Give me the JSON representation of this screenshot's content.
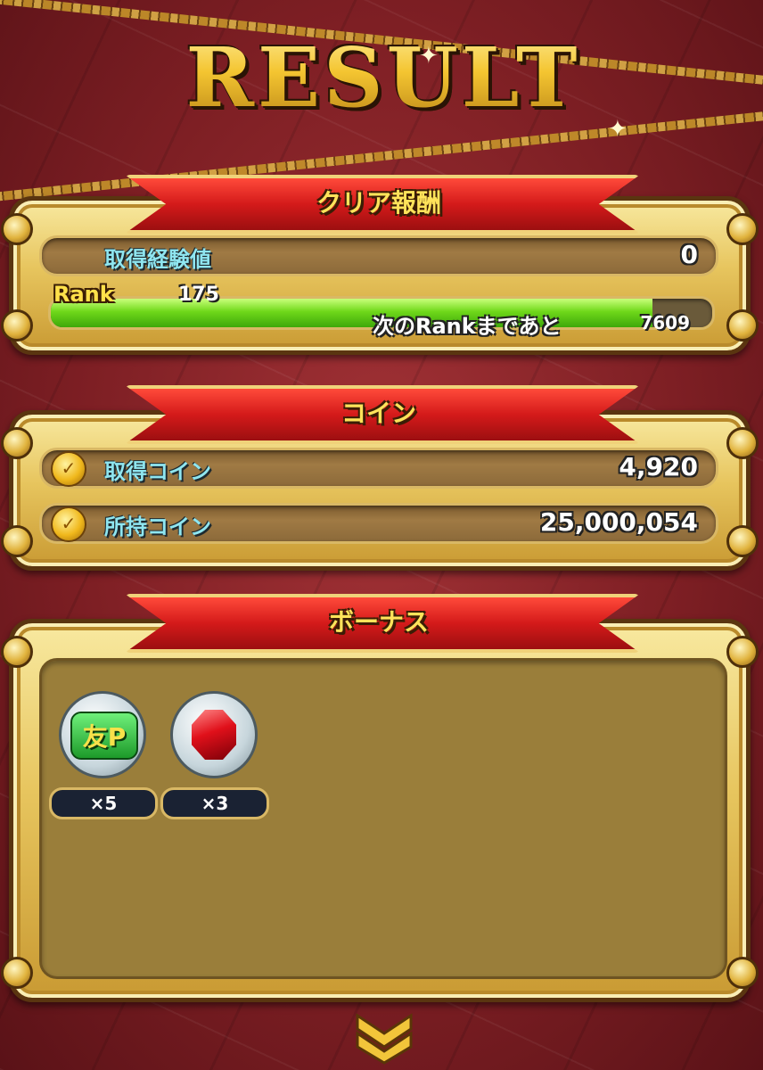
{
  "title": "RESULT",
  "sections": {
    "clear_reward": {
      "header": "クリア報酬",
      "exp_label": "取得経験値",
      "exp_value": "0",
      "rank_label": "Rank",
      "rank_value": "175",
      "next_rank_label": "次のRankまであと",
      "next_rank_value": "7609",
      "rank_progress_fraction": 0.91
    },
    "coins": {
      "header": "コイン",
      "earned_label": "取得コイン",
      "earned_value": "4,920",
      "owned_label": "所持コイン",
      "owned_value": "25,000,054",
      "icon": "coin-icon"
    },
    "bonus": {
      "header": "ボーナス",
      "items": [
        {
          "icon": "friend-point-icon",
          "glyph": "友P",
          "count": "×5"
        },
        {
          "icon": "red-gem-icon",
          "count": "×3"
        }
      ]
    }
  },
  "colors": {
    "background": "#8a2529",
    "panel_gold": "#e7c55e",
    "ribbon_red": "#d41a1a",
    "label_cyan": "#8fe6f0",
    "progress_green": "#6fd81a"
  },
  "navigation": {
    "next_icon": "chevron-down-icon"
  }
}
